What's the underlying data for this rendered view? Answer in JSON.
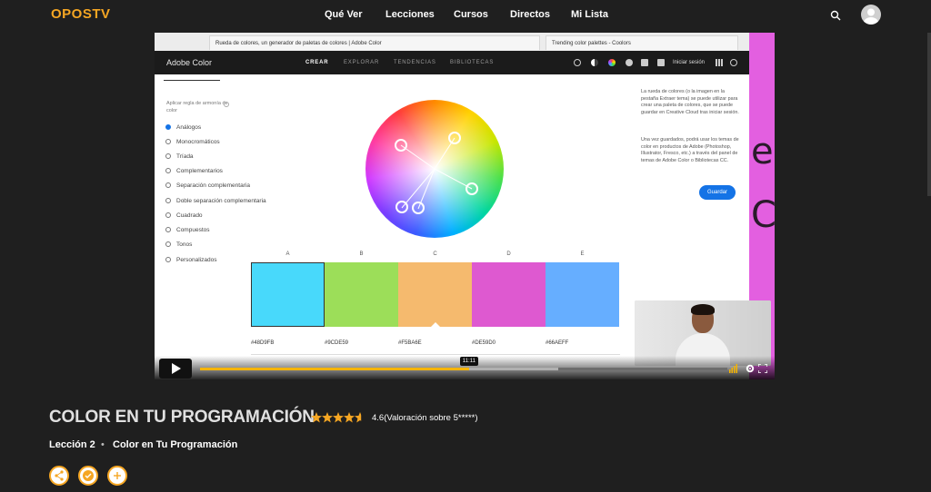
{
  "nav": {
    "logo": "OPOSTV",
    "items": [
      "Qué Ver",
      "Lecciones",
      "Cursos",
      "Directos",
      "Mi Lista"
    ],
    "icons": [
      "search-icon",
      "avatar"
    ]
  },
  "browser": {
    "tabs": [
      "Rueda de colores, un generador de paletas de colores | Adobe Color",
      "Trending color palettes - Coolors"
    ]
  },
  "adobe": {
    "title": "Adobe Color",
    "nav": [
      "CREAR",
      "EXPLORAR",
      "TENDENCIAS",
      "BIBLIOTECAS"
    ],
    "signin": "Iniciar sesión",
    "rule_label": "Aplicar regla de armonía de color",
    "rules": [
      "Análogos",
      "Monocromáticos",
      "Tríada",
      "Complementarios",
      "Separación complementaria",
      "Doble separación complementaria",
      "Cuadrado",
      "Compuestos",
      "Tonos",
      "Personalizados"
    ],
    "selected_rule": "Análogos",
    "swatches": [
      {
        "label": "A",
        "hex": "#48D9FB",
        "color": "#48D9FB"
      },
      {
        "label": "B",
        "hex": "#9CDE59",
        "color": "#9CDE59"
      },
      {
        "label": "C",
        "hex": "#F5BA6E",
        "color": "#F5BA6E"
      },
      {
        "label": "D",
        "hex": "#DE59D0",
        "color": "#DE59D0"
      },
      {
        "label": "E",
        "hex": "#66AEFF",
        "color": "#66AEFF"
      }
    ],
    "desc1": "La rueda de colores (o la imagen en la pestaña Extraer tema) se puede utilizar para crear una paleta de colores, que se puede guardar en Creative Cloud tras iniciar sesión.",
    "desc2": "Una vez guardados, podrá usar los temas de color en productos de Adobe (Photoshop, Illustrator, Fresco, etc.) a través del panel de temas de Adobe Color o Bibliotecas CC.",
    "save": "Guardar",
    "side_letters": [
      "e",
      "C"
    ]
  },
  "player": {
    "time": "11:11",
    "progress": 0.51,
    "buffered": 0.68
  },
  "course": {
    "title": "COLOR EN TU PROGRAMACIÓN",
    "rating": "4.6(Valoración sobre 5*****)",
    "stars": 4.6,
    "lesson": "Lección 2",
    "separator": "•",
    "lesson_name": "Color en Tu Programación"
  },
  "colors": {
    "accent": "#f5a623",
    "adobe_blue": "#1473e6",
    "progress": "#f5b400"
  }
}
